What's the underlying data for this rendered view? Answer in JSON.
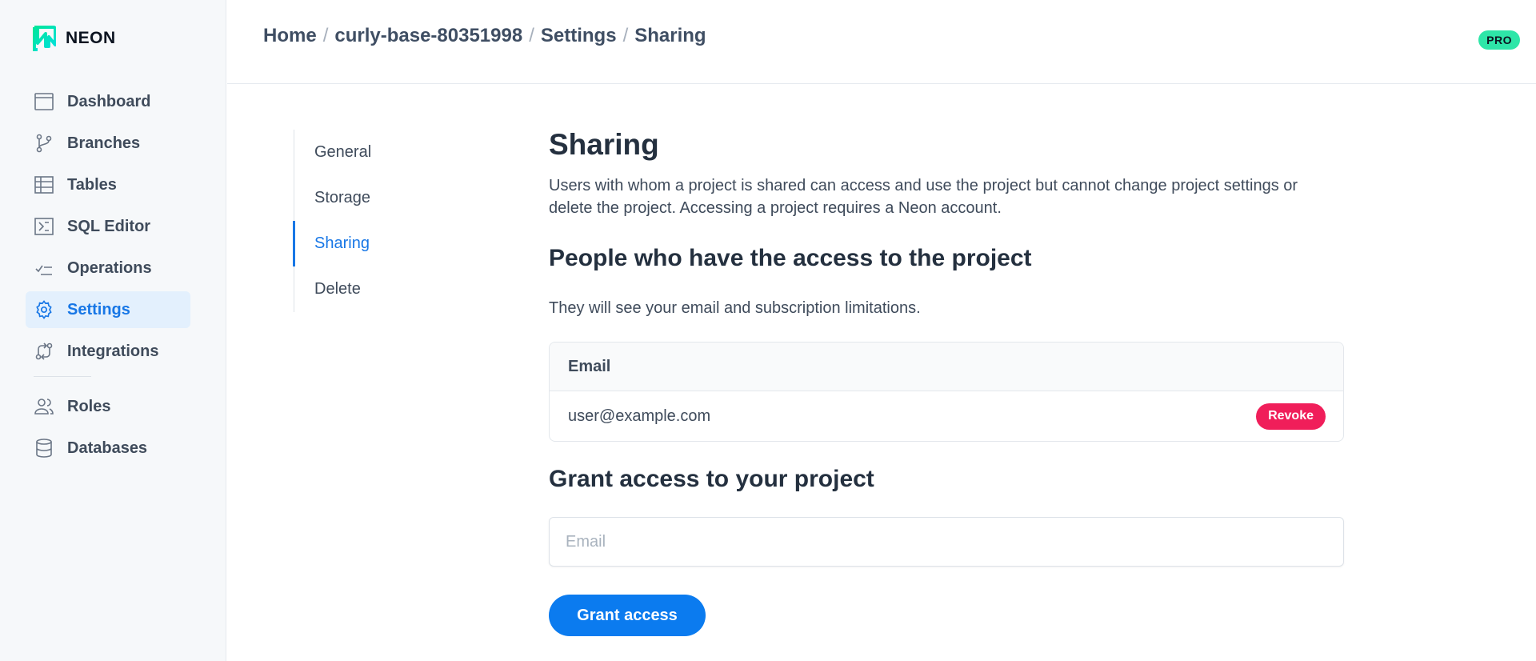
{
  "brand": {
    "name": "NEON"
  },
  "sidebar": {
    "items": [
      {
        "label": "Dashboard",
        "icon": "dashboard-icon"
      },
      {
        "label": "Branches",
        "icon": "branch-icon"
      },
      {
        "label": "Tables",
        "icon": "table-icon"
      },
      {
        "label": "SQL Editor",
        "icon": "terminal-icon"
      },
      {
        "label": "Operations",
        "icon": "operations-icon"
      },
      {
        "label": "Settings",
        "icon": "gear-icon",
        "active": true
      },
      {
        "label": "Integrations",
        "icon": "integrations-icon"
      },
      {
        "label": "Roles",
        "icon": "users-icon"
      },
      {
        "label": "Databases",
        "icon": "database-icon"
      }
    ]
  },
  "header": {
    "breadcrumb": [
      "Home",
      "curly-base-80351998",
      "Settings",
      "Sharing"
    ],
    "separator": "/",
    "badge": "PRO"
  },
  "subnav": {
    "items": [
      "General",
      "Storage",
      "Sharing",
      "Delete"
    ],
    "active": "Sharing"
  },
  "main": {
    "title": "Sharing",
    "description": "Users with whom a project is shared can access and use the project but cannot change project settings or delete the project. Accessing a project requires a Neon account.",
    "people_title": "People who have the access to the project",
    "people_subtext": "They will see your email and subscription limitations.",
    "table": {
      "header": "Email",
      "rows": [
        {
          "email": "user@example.com",
          "action": "Revoke"
        }
      ]
    },
    "grant_title": "Grant access to your project",
    "email_placeholder": "Email",
    "email_value": "",
    "grant_button": "Grant access"
  },
  "colors": {
    "accent": "#1877e6",
    "primary_button": "#0b7bef",
    "danger": "#f01e5a",
    "pro_badge": "#2ee6a8",
    "sidebar_bg": "#f6f8fa"
  }
}
